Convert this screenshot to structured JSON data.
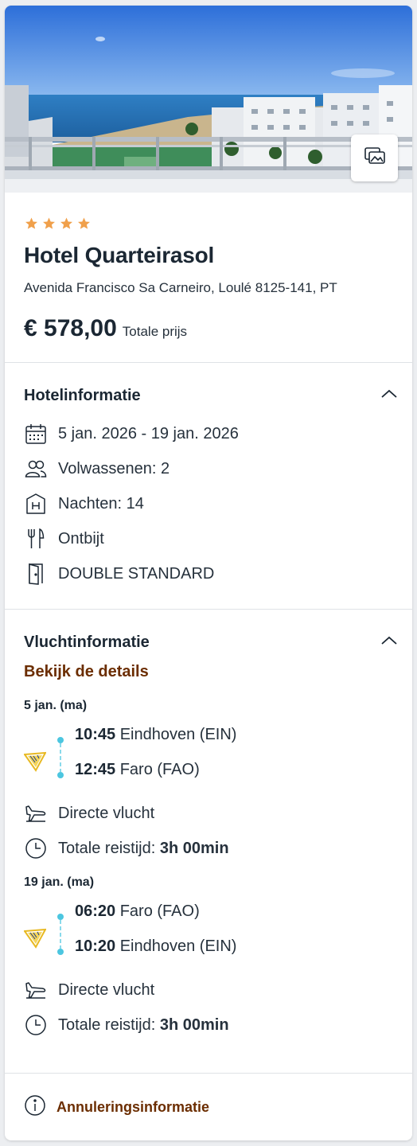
{
  "icons": {
    "gallery": "gallery-icon",
    "star": "star-icon",
    "calendar": "calendar-icon",
    "people": "people-icon",
    "hotel": "hotel-h-icon",
    "cutlery": "cutlery-icon",
    "door": "door-icon",
    "chevron": "chevron-up-icon",
    "airline": "airline-logo-icon",
    "plane": "plane-landing-icon",
    "clock": "clock-icon",
    "info": "info-icon"
  },
  "colors": {
    "star": "#f0a04b",
    "link": "#6b2d00",
    "timeline": "#4cc6e0",
    "airline": "#e8b923"
  },
  "hotel": {
    "stars": 4,
    "name": "Hotel Quarteirasol",
    "address": "Avenida Francisco Sa Carneiro, Loulé 8125-141, PT",
    "price": "€ 578,00",
    "price_label": "Totale prijs"
  },
  "hotel_info": {
    "title": "Hotelinformatie",
    "dates": "5 jan. 2026 - 19 jan. 2026",
    "adults": "Volwassenen: 2",
    "nights": "Nachten: 14",
    "board": "Ontbijt",
    "room": "DOUBLE STANDARD"
  },
  "flight_info": {
    "title": "Vluchtinformatie",
    "details_link": "Bekijk de details",
    "outbound": {
      "day": "5 jan. (ma)",
      "dep_time": "10:45",
      "dep_place": "Eindhoven (EIN)",
      "arr_time": "12:45",
      "arr_place": "Faro (FAO)",
      "type": "Directe vlucht",
      "duration_label": "Totale reistijd:",
      "duration": "3h 00min"
    },
    "return": {
      "day": "19 jan. (ma)",
      "dep_time": "06:20",
      "dep_place": "Faro (FAO)",
      "arr_time": "10:20",
      "arr_place": "Eindhoven (EIN)",
      "type": "Directe vlucht",
      "duration_label": "Totale reistijd:",
      "duration": "3h 00min"
    }
  },
  "cancellation": {
    "label": "Annuleringsinformatie"
  }
}
